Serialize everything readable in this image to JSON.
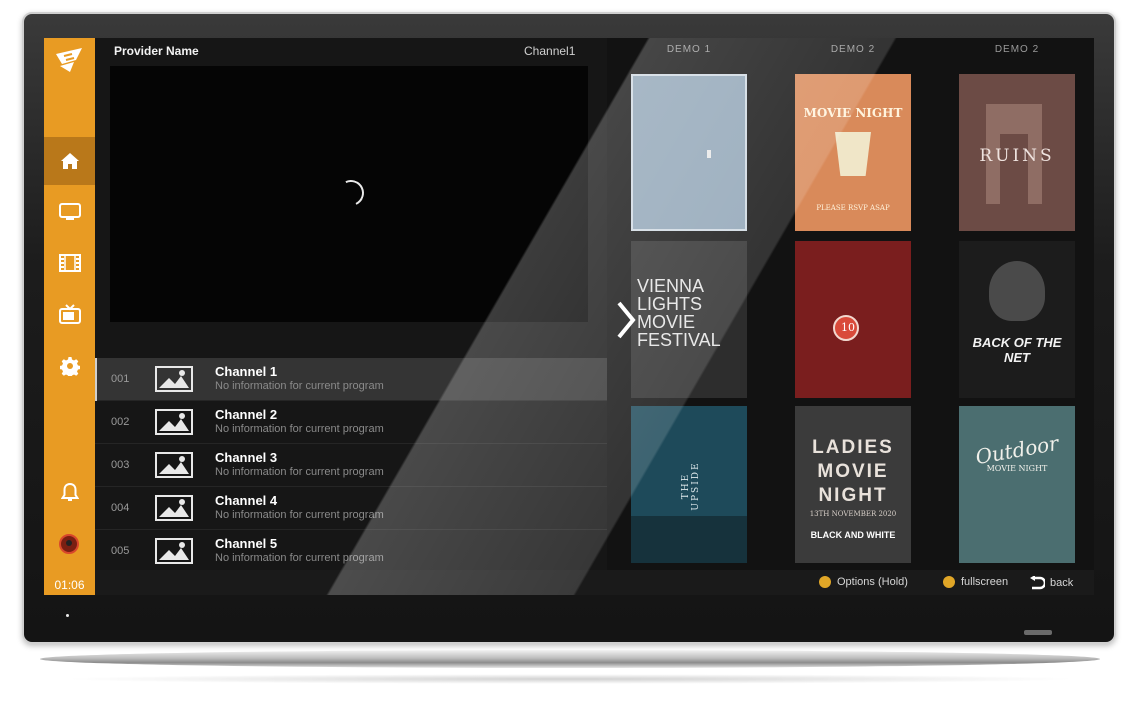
{
  "app": {
    "provider_name": "Provider Name",
    "current_channel": "Channel1",
    "clock": "01:06"
  },
  "sidebar": {
    "items": [
      {
        "icon": "home-icon",
        "active": true
      },
      {
        "icon": "monitor-icon",
        "active": false
      },
      {
        "icon": "film-icon",
        "active": false
      },
      {
        "icon": "tv-icon",
        "active": false
      },
      {
        "icon": "gear-icon",
        "active": false
      },
      {
        "icon": "bell-icon",
        "active": false
      }
    ],
    "accent": "#e89b23"
  },
  "channels": [
    {
      "number": "001",
      "name": "Channel 1",
      "info": "No information for current program"
    },
    {
      "number": "002",
      "name": "Channel 2",
      "info": "No information for current program"
    },
    {
      "number": "003",
      "name": "Channel 3",
      "info": "No information for current program"
    },
    {
      "number": "004",
      "name": "Channel 4",
      "info": "No information for current program"
    },
    {
      "number": "005",
      "name": "Channel 5",
      "info": "No information for current program"
    }
  ],
  "grid": {
    "columns": [
      "DEMO 1",
      "DEMO 2",
      "DEMO 2"
    ],
    "posters": [
      {
        "title": "",
        "lines": []
      },
      {
        "title": "MOVIE NIGHT",
        "lines": [
          "PLEASE RSVP ASAP"
        ]
      },
      {
        "title": "RUINS",
        "lines": []
      },
      {
        "title": "VIENNA LIGHTS MOVIE FESTIVAL",
        "lines": []
      },
      {
        "title": "10",
        "lines": []
      },
      {
        "title": "BACK OF THE NET",
        "lines": []
      },
      {
        "title": "THE UPSIDE",
        "lines": []
      },
      {
        "title": "LADIES MOVIE NIGHT",
        "lines": [
          "13TH NOVEMBER 2020",
          "BLACK AND WHITE"
        ]
      },
      {
        "title": "Outdoor",
        "lines": [
          "MOVIE NIGHT"
        ]
      }
    ]
  },
  "bottom_bar": {
    "options_label": "Options (Hold)",
    "fullscreen_label": "fullscreen",
    "back_label": "back"
  }
}
